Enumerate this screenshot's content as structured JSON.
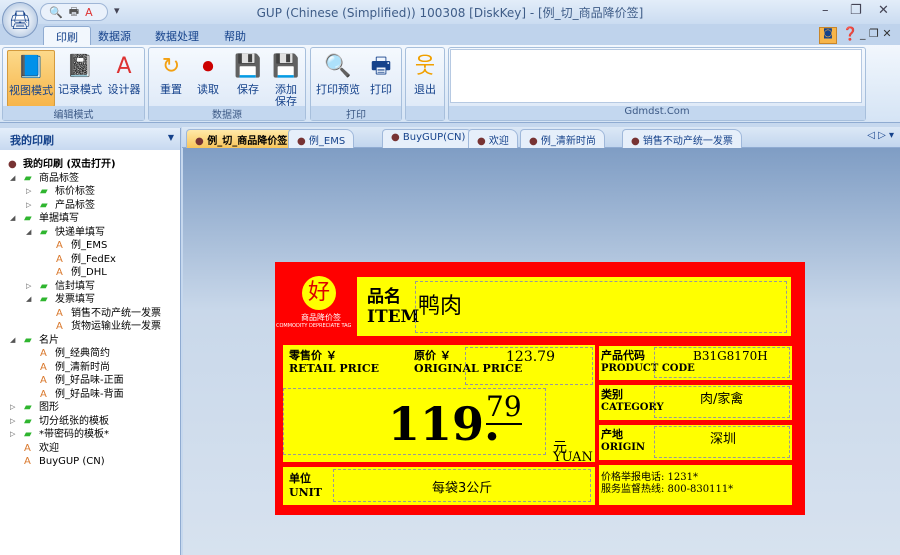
{
  "window": {
    "title": "GUP (Chinese (Simplified)) 100308 [DiskKey] - [例_切_商品降价签]",
    "min": "–",
    "max": "❐",
    "close": "✕"
  },
  "qat": {
    "icons": [
      "preview-icon",
      "print-icon",
      "designer-icon"
    ],
    "dropdown": "▾"
  },
  "ribbon_tabs": [
    "印刷",
    "数据源",
    "数据处理",
    "帮助"
  ],
  "groups": [
    {
      "label": "编辑模式",
      "buttons": [
        "视图模式",
        "记录模式",
        "设计器"
      ]
    },
    {
      "label": "数据源",
      "buttons": [
        "重置",
        "读取",
        "保存",
        "添加\n保存"
      ]
    },
    {
      "label": "打印",
      "buttons": [
        "打印预览",
        "打印"
      ]
    },
    {
      "label": "",
      "buttons": [
        "退出"
      ]
    },
    {
      "label": "Gdmdst.Com"
    }
  ],
  "sidebar": {
    "title": "我的印刷",
    "items": [
      {
        "text": "我的印刷 (双击打开)",
        "level": 0,
        "type": "root"
      },
      {
        "text": "商品标签",
        "level": 1,
        "type": "folder",
        "exp": "open"
      },
      {
        "text": "标价标签",
        "level": 2,
        "type": "folder",
        "exp": "closed"
      },
      {
        "text": "产品标签",
        "level": 2,
        "type": "folder",
        "exp": "closed"
      },
      {
        "text": "单据填写",
        "level": 1,
        "type": "folder",
        "exp": "open"
      },
      {
        "text": "快递单填写",
        "level": 2,
        "type": "folder",
        "exp": "open"
      },
      {
        "text": "例_EMS",
        "level": 3,
        "type": "doc"
      },
      {
        "text": "例_FedEx",
        "level": 3,
        "type": "doc"
      },
      {
        "text": "例_DHL",
        "level": 3,
        "type": "doc"
      },
      {
        "text": "信封填写",
        "level": 2,
        "type": "folder",
        "exp": "closed"
      },
      {
        "text": "发票填写",
        "level": 2,
        "type": "folder",
        "exp": "open"
      },
      {
        "text": "销售不动产统一发票",
        "level": 3,
        "type": "doc"
      },
      {
        "text": "货物运输业统一发票",
        "level": 3,
        "type": "doc"
      },
      {
        "text": "名片",
        "level": 1,
        "type": "folder",
        "exp": "open"
      },
      {
        "text": "例_经典简约",
        "level": 2,
        "type": "doc"
      },
      {
        "text": "例_清新时尚",
        "level": 2,
        "type": "doc"
      },
      {
        "text": "例_好品味-正面",
        "level": 2,
        "type": "doc"
      },
      {
        "text": "例_好品味-背面",
        "level": 2,
        "type": "doc"
      },
      {
        "text": "图形",
        "level": 1,
        "type": "folder",
        "exp": "closed"
      },
      {
        "text": "切分纸张的模板",
        "level": 1,
        "type": "folder",
        "exp": "closed"
      },
      {
        "text": "*带密码的模板*",
        "level": 1,
        "type": "folder",
        "exp": "closed"
      },
      {
        "text": "欢迎",
        "level": 1,
        "type": "doc"
      },
      {
        "text": "BuyGUP (CN)",
        "level": 1,
        "type": "doc"
      }
    ]
  },
  "doc_tabs": [
    "例_切_商品降价签",
    "例_EMS",
    "BuyGUP(CN)",
    "欢迎",
    "例_清新时尚",
    "销售不动产统一发票"
  ],
  "doc_tab_close": "×",
  "doc_nav": "◁ ▷ ▾",
  "label": {
    "logo_char": "好",
    "logo_cn": "商品降价签",
    "logo_en": "COMMODITY DEPRECIATE TAG",
    "item_cn": "品名",
    "item_en": "ITEM",
    "item_value": "鸭肉",
    "retail_cn": "零售价 ￥",
    "retail_en": "RETAIL PRICE",
    "orig_cn": "原价 ￥",
    "orig_en": "ORIGINAL PRICE",
    "orig_value": "123.79",
    "price_int": "119.",
    "price_dec": "79",
    "yuan_cn": "元",
    "yuan_en": "YUAN",
    "unit_cn": "单位",
    "unit_en": "UNIT",
    "unit_value": "每袋3公斤",
    "code_cn": "产品代码",
    "code_en": "PRODUCT CODE",
    "code_value": "B31G8170H",
    "cat_cn": "类别",
    "cat_en": "CATEGORY",
    "cat_value": "肉/家禽",
    "origin_cn": "产地",
    "origin_en": "ORIGIN",
    "origin_value": "深圳",
    "hotline1": "价格举报电话: 1231*",
    "hotline2": "服务监督热线: 800-830111*"
  }
}
